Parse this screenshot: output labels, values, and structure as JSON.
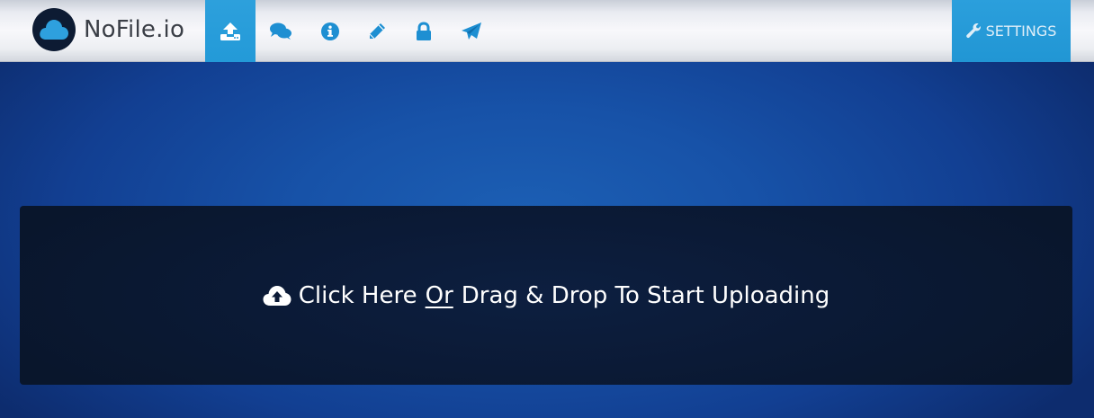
{
  "brand": {
    "name": "NoFile.io",
    "logo_icon": "cloud-logo-icon"
  },
  "nav": {
    "items": [
      {
        "icon": "upload-icon",
        "active": true
      },
      {
        "icon": "comments-icon",
        "active": false
      },
      {
        "icon": "info-icon",
        "active": false
      },
      {
        "icon": "pencil-icon",
        "active": false
      },
      {
        "icon": "lock-icon",
        "active": false
      },
      {
        "icon": "paper-plane-icon",
        "active": false
      }
    ],
    "settings_label": "SETTINGS",
    "settings_icon": "wrench-icon"
  },
  "dropzone": {
    "prefix": "Click Here",
    "or": "Or",
    "suffix": "Drag & Drop To Start Uploading",
    "icon": "cloud-upload-icon"
  },
  "colors": {
    "accent": "#239ad8",
    "icon": "#1e8fd2",
    "background": "#1752a8",
    "dropzone": "#0b1a36",
    "brand_text": "#3b3f47"
  }
}
